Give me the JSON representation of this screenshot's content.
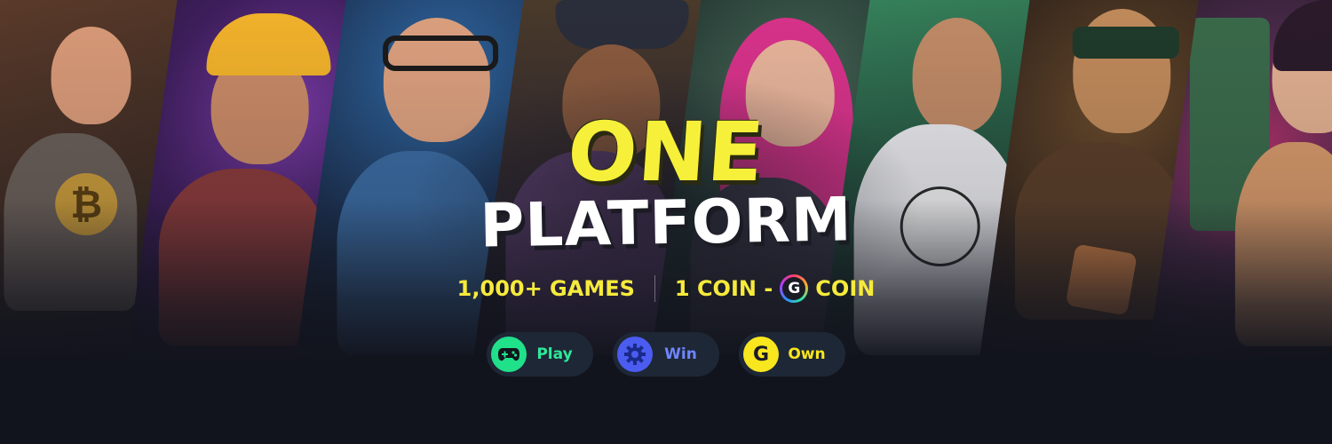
{
  "headline": {
    "line1": "ONE",
    "line2": "PLATFORM"
  },
  "tagline": {
    "games": "1,000+ GAMES",
    "coin_prefix": "1 COIN -",
    "coin_icon_letter": "G",
    "coin_suffix": "COIN"
  },
  "actions": [
    {
      "label": "Play",
      "icon": "gamepad-icon",
      "color": "#21e08a"
    },
    {
      "label": "Win",
      "icon": "gear-icon",
      "color": "#4b5cf0"
    },
    {
      "label": "Own",
      "icon": "g-coin-icon",
      "icon_letter": "G",
      "color": "#f8e61e"
    }
  ],
  "colors": {
    "background": "#12141d",
    "headline_yellow": "#f7f03a",
    "tagline_yellow": "#f6ea3c"
  }
}
